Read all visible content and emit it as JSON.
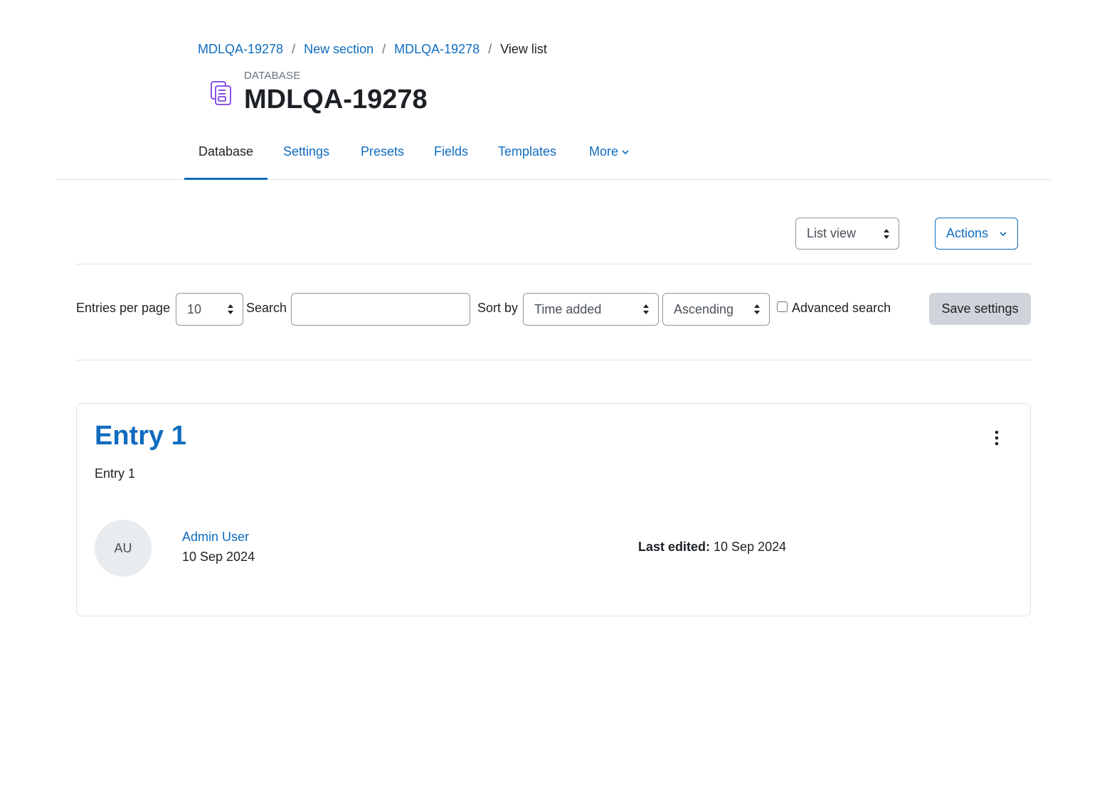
{
  "breadcrumb": {
    "items": [
      "MDLQA-19278",
      "New section",
      "MDLQA-19278"
    ],
    "current": "View list",
    "separator": "/"
  },
  "header": {
    "icon": "database-icon",
    "purpose": "DATABASE",
    "title": "MDLQA-19278"
  },
  "secondary_nav": {
    "tabs": [
      {
        "label": "Database",
        "active": true
      },
      {
        "label": "Settings",
        "active": false
      },
      {
        "label": "Presets",
        "active": false
      },
      {
        "label": "Fields",
        "active": false
      },
      {
        "label": "Templates",
        "active": false
      },
      {
        "label": "More",
        "active": false,
        "icon": "chevron-down-icon"
      }
    ]
  },
  "view_toolbar": {
    "view_select": "List view",
    "actions_label": "Actions"
  },
  "filters": {
    "entries_per_page_label": "Entries per page",
    "entries_per_page_value": "10",
    "search_label": "Search",
    "search_value": "",
    "sort_by_label": "Sort by",
    "sort_field": "Time added",
    "sort_order": "Ascending",
    "advanced_search_label": "Advanced search",
    "advanced_search_checked": false,
    "save_label": "Save settings"
  },
  "entry": {
    "title": "Entry 1",
    "content": "Entry 1",
    "avatar_initials": "AU",
    "author": "Admin User",
    "date": "10 Sep 2024",
    "last_edited_label": "Last edited:",
    "last_edited_value": "10 Sep 2024",
    "menu_icon": "kebab-menu-icon"
  },
  "colors": {
    "link": "#0f6cbf",
    "text": "#1d2125",
    "muted": "#6a737b",
    "border": "#dee2e6",
    "icon_accent": "#7b3fe4"
  }
}
